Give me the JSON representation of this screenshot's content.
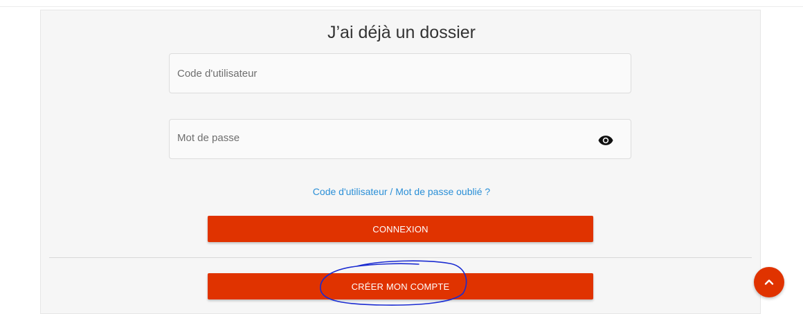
{
  "login": {
    "title": "J’ai déjà un dossier",
    "username_placeholder": "Code d'utilisateur",
    "password_placeholder": "Mot de passe",
    "forgot_link": "Code d'utilisateur / Mot de passe oublié ?",
    "login_button": "CONNEXION",
    "create_button": "CRÉER MON COMPTE"
  },
  "icons": {
    "password_toggle": "eye-icon",
    "scroll_top": "chevron-up-icon"
  },
  "colors": {
    "accent": "#e03300",
    "link": "#2a8fd7",
    "panel": "#f6f6f6",
    "annotation": "#1a2bd1"
  }
}
